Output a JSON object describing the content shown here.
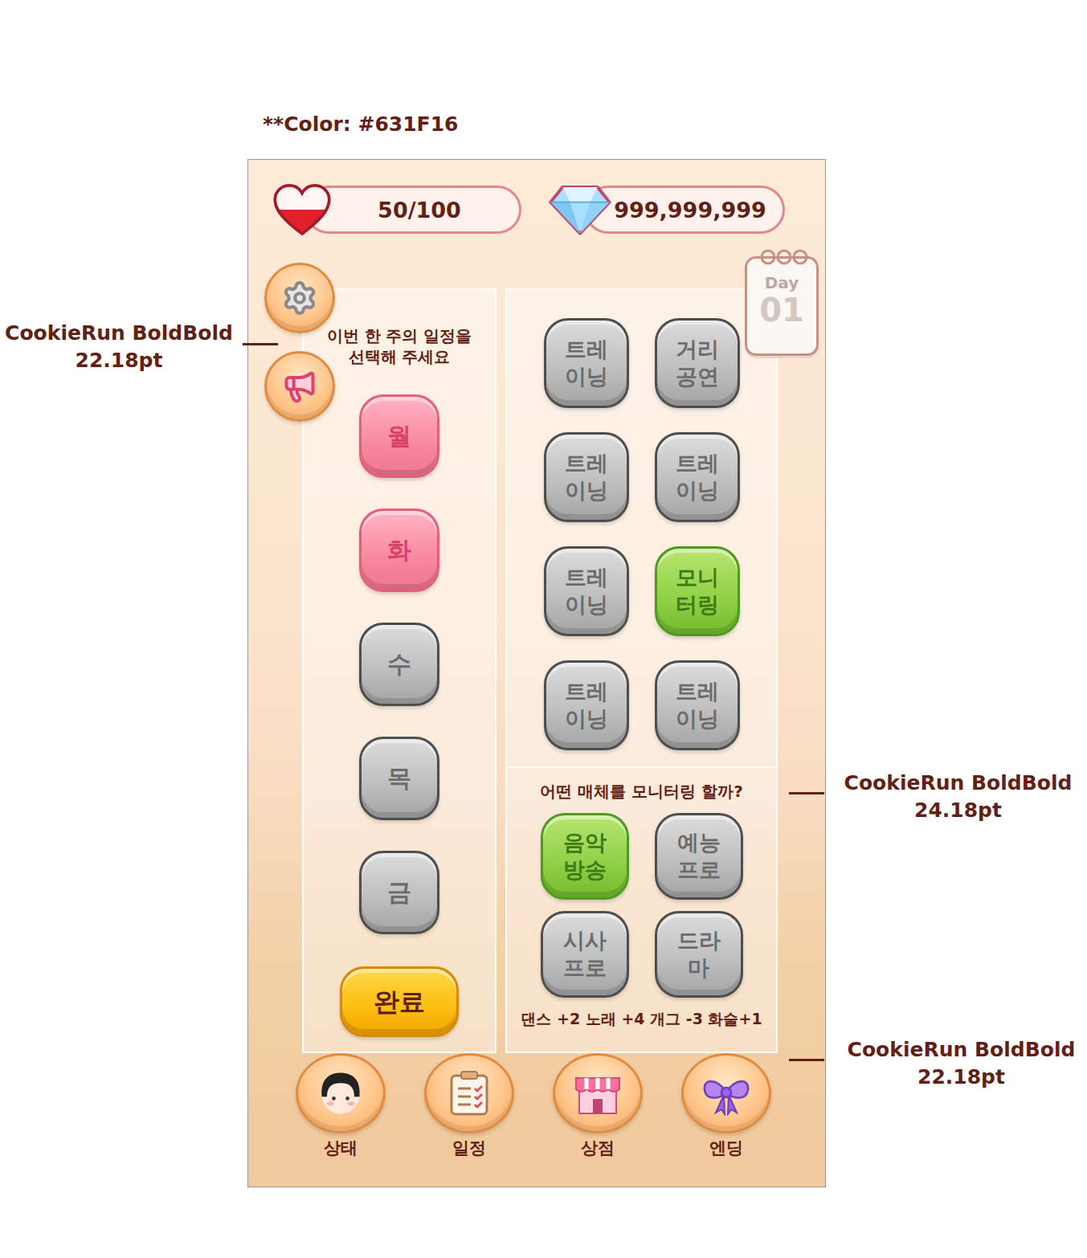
{
  "annotations": {
    "color_note": "**Color: #631F16",
    "schedule_prompt_spec": {
      "name": "CookieRun BoldBold",
      "size": "22.18pt"
    },
    "media_prompt_spec": {
      "name": "CookieRun BoldBold",
      "size": "24.18pt"
    },
    "effects_spec": {
      "name": "CookieRun BoldBold",
      "size": "22.18pt"
    }
  },
  "status_bar": {
    "health": {
      "value": "50/100",
      "level": 0.5
    },
    "gems": "999,999,999"
  },
  "calendar": {
    "label": "Day",
    "number": "01"
  },
  "schedule": {
    "prompt": [
      "이번 한 주의 일정을",
      "선택해 주세요"
    ],
    "days": [
      {
        "label": "월",
        "selected": true
      },
      {
        "label": "화",
        "selected": true
      },
      {
        "label": "수",
        "selected": false
      },
      {
        "label": "목",
        "selected": false
      },
      {
        "label": "금",
        "selected": false
      }
    ],
    "confirm": "완료"
  },
  "activities": [
    {
      "lines": [
        "트레",
        "이닝"
      ],
      "selected": false
    },
    {
      "lines": [
        "거리",
        "공연"
      ],
      "selected": false
    },
    {
      "lines": [
        "트레",
        "이닝"
      ],
      "selected": false
    },
    {
      "lines": [
        "트레",
        "이닝"
      ],
      "selected": false
    },
    {
      "lines": [
        "트레",
        "이닝"
      ],
      "selected": false
    },
    {
      "lines": [
        "모니",
        "터링"
      ],
      "selected": true
    },
    {
      "lines": [
        "트레",
        "이닝"
      ],
      "selected": false
    },
    {
      "lines": [
        "트레",
        "이닝"
      ],
      "selected": false
    }
  ],
  "monitoring": {
    "prompt": "어떤 매체를 모니터링 할까?",
    "media": [
      {
        "lines": [
          "음악",
          "방송"
        ],
        "selected": true
      },
      {
        "lines": [
          "예능",
          "프로"
        ],
        "selected": false
      },
      {
        "lines": [
          "시사",
          "프로"
        ],
        "selected": false
      },
      {
        "lines": [
          "드라",
          "마"
        ],
        "selected": false
      }
    ],
    "effects": "댄스 +2 노래 +4 개그 -3 화술+1"
  },
  "nav": [
    {
      "label": "상태"
    },
    {
      "label": "일정"
    },
    {
      "label": "상점"
    },
    {
      "label": "엔딩"
    }
  ]
}
